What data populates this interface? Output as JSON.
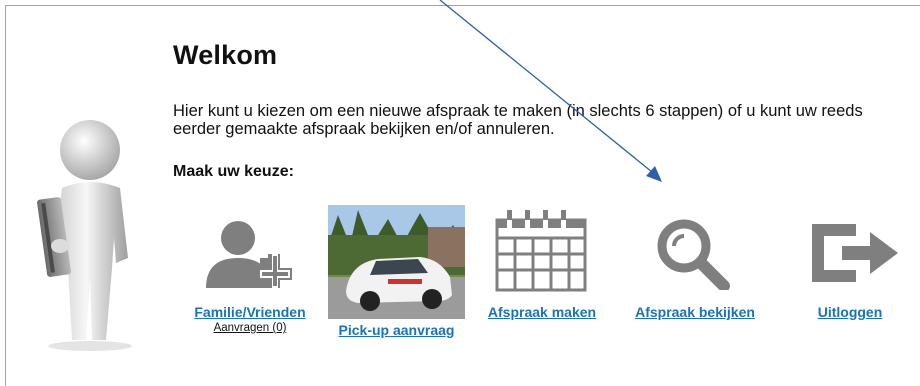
{
  "welcome": {
    "title": "Welkom",
    "intro_line1": "Hier kunt u kiezen om een nieuwe afspraak te maken (in slechts 6 stappen) of u kunt uw reeds",
    "intro_line2": "eerder gemaakte afspraak bekijken en/of annuleren.",
    "choose_label": "Maak uw keuze:"
  },
  "options": [
    {
      "label": "Familie/Vrienden",
      "sub": "Aanvragen (0)",
      "icon": "add-user-icon"
    },
    {
      "label": "Pick-up aanvraag",
      "icon": "car-photo"
    },
    {
      "label": "Afspraak maken",
      "icon": "calendar-icon"
    },
    {
      "label": "Afspraak bekijken",
      "icon": "search-icon"
    },
    {
      "label": "Uitloggen",
      "icon": "logout-icon"
    }
  ],
  "colors": {
    "link": "#1a73b9",
    "icon_gray": "#7f7f7f",
    "arrow": "#2e5fa8",
    "frame": "#8aa8c8"
  }
}
